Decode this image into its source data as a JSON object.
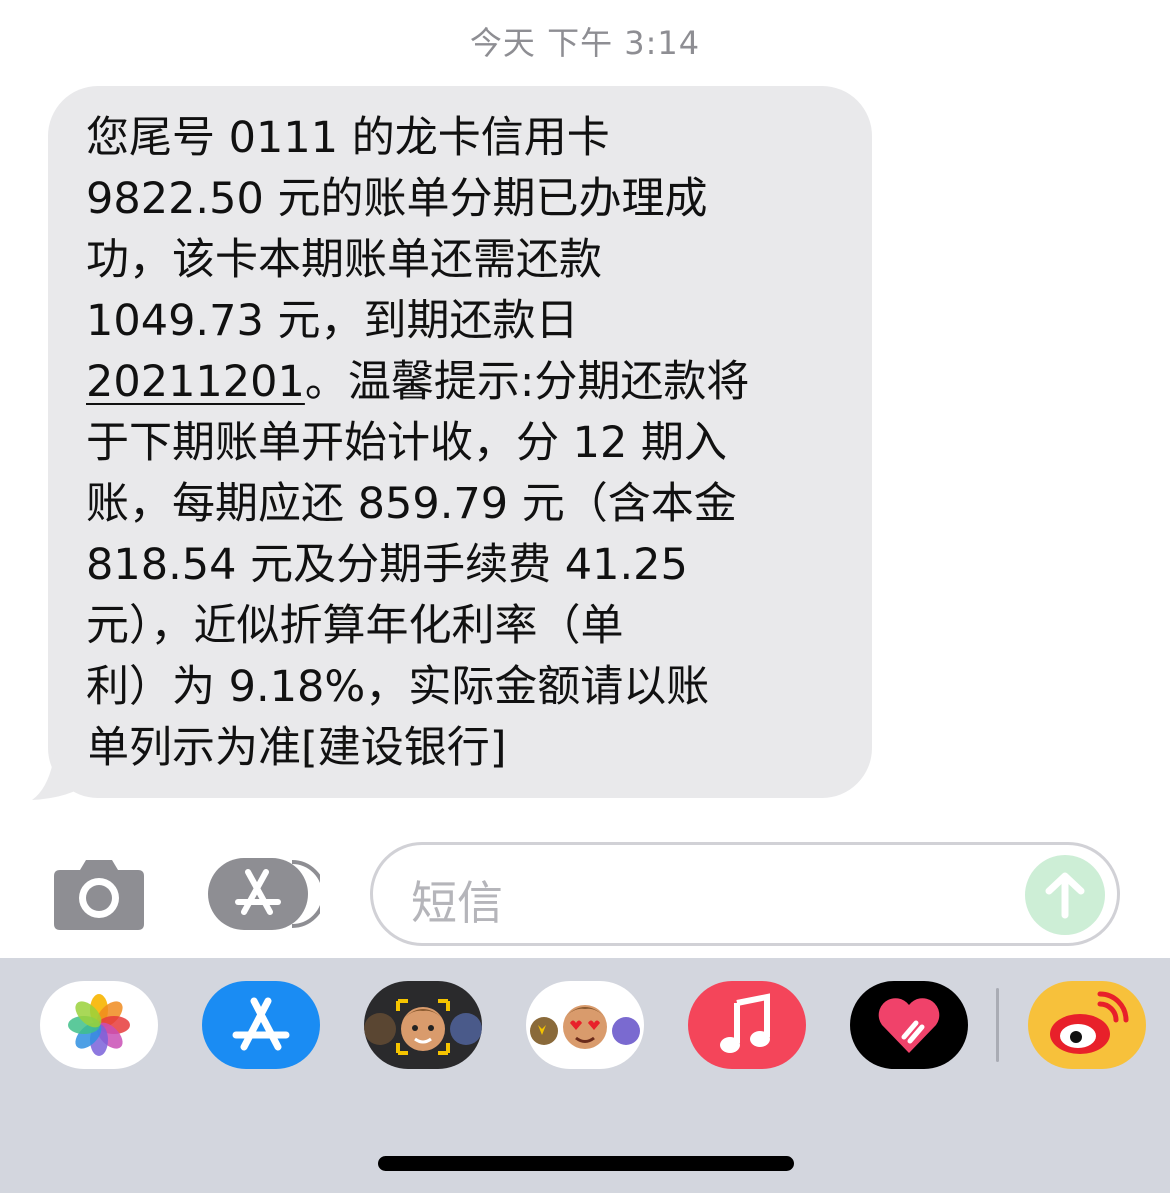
{
  "header": {
    "timestamp": "今天 下午 3:14"
  },
  "message": {
    "lines": [
      "您尾号 0111 的龙卡信用卡",
      "9822.50 元的账单分期已办理成",
      "功，该卡本期账单还需还款",
      "1049.73 元，到期还款日",
      "20211201",
      "。温馨提示:分期还款将",
      "于下期账单开始计收，分 12 期入",
      "账，每期应还 859.79 元（含本金",
      "818.54 元及分期手续费 41.25",
      "元），近似折算年化利率（单",
      "利）为 9.18%，实际金额请以账",
      "单列示为准[建设银行]"
    ]
  },
  "composer": {
    "placeholder": "短信",
    "camera_icon": "camera-icon",
    "apps_icon": "app-store-icon",
    "send_icon": "arrow-up-icon"
  },
  "app_tray": {
    "apps": [
      "photos",
      "app-store",
      "memoji-camera",
      "memoji-stickers",
      "music",
      "digital-touch",
      "weibo"
    ]
  },
  "colors": {
    "bubble": "#e9e9eb",
    "send_button": "#cdeed6",
    "tray": "#d3d6de",
    "app_store_blue": "#1a8cf3",
    "music_red": "#f4455a",
    "weibo_yellow": "#f7c13b"
  }
}
